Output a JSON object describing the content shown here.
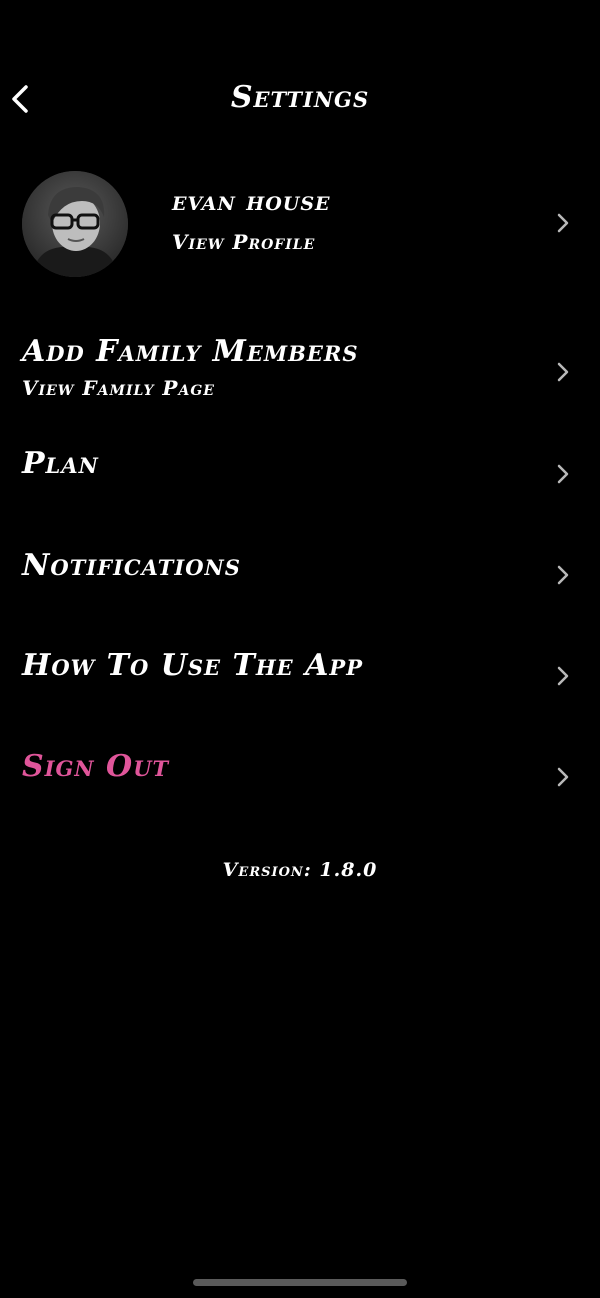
{
  "header": {
    "title": "Settings",
    "back_icon": "chevron-left-icon"
  },
  "profile": {
    "name": "evan house",
    "subtitle": "View Profile",
    "avatar": "avatar-photo"
  },
  "menu": [
    {
      "label": "Add Family Members",
      "sublabel": "View Family Page"
    },
    {
      "label": "Plan"
    },
    {
      "label": "Notifications"
    },
    {
      "label": "How To Use The App"
    },
    {
      "label": "Sign Out"
    }
  ],
  "version_text": "Version: 1.8.0",
  "colors": {
    "background": "#000000",
    "text": "#ffffff",
    "sign_out": "#e0559a",
    "chevron": "#b9b9b9",
    "home_indicator": "#5a5a5a"
  }
}
